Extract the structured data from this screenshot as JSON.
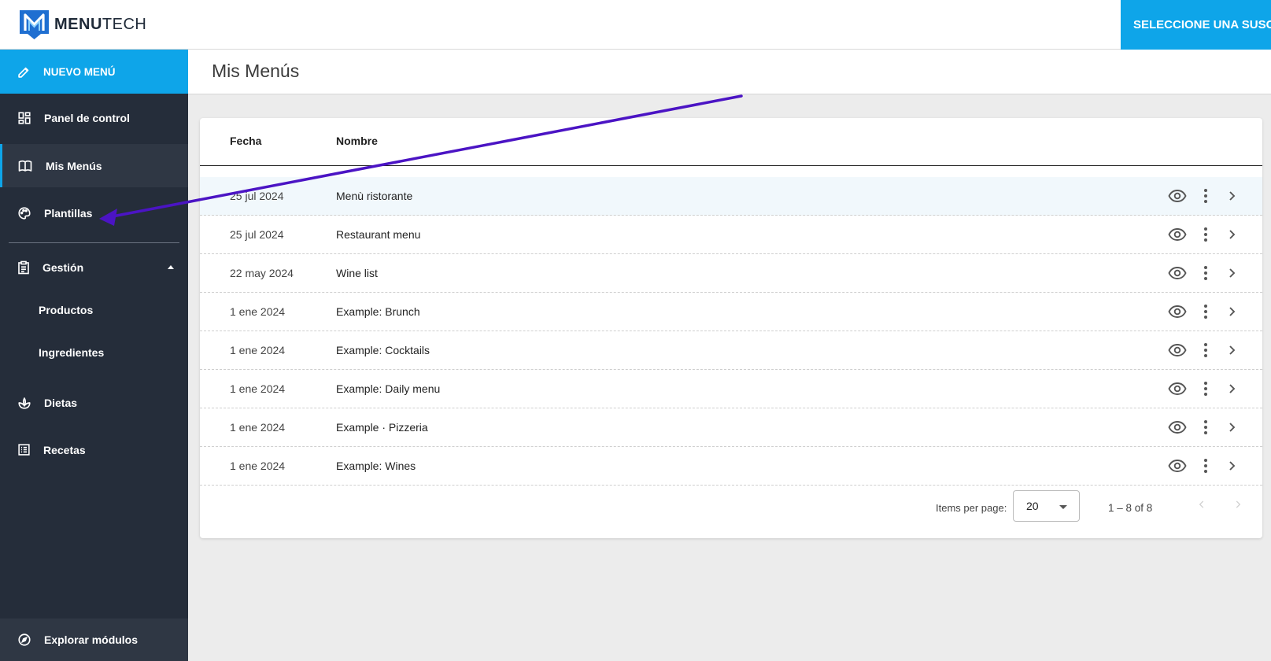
{
  "header": {
    "logo_bold": "MENU",
    "logo_light": "TECH",
    "subscribe_label": "SELECCIONE UNA SUSCR"
  },
  "sidebar": {
    "new_menu_label": "NUEVO MENÚ",
    "items": [
      {
        "label": "Panel de control",
        "icon": "dashboard-icon"
      },
      {
        "label": "Mis Menús",
        "icon": "book-icon",
        "active": true
      },
      {
        "label": "Plantillas",
        "icon": "palette-icon"
      }
    ],
    "management": {
      "label": "Gestión",
      "icon": "clipboard-icon",
      "expanded": true,
      "children": [
        {
          "label": "Productos"
        },
        {
          "label": "Ingredientes"
        }
      ]
    },
    "extra_items": [
      {
        "label": "Dietas",
        "icon": "sprout-icon"
      },
      {
        "label": "Recetas",
        "icon": "list-icon"
      }
    ],
    "explore_label": "Explorar módulos"
  },
  "page": {
    "title": "Mis Menús"
  },
  "table": {
    "columns": [
      "Fecha",
      "Nombre"
    ],
    "rows": [
      {
        "date": "25 jul 2024",
        "name": "Menù ristorante"
      },
      {
        "date": "25 jul 2024",
        "name": "Restaurant menu"
      },
      {
        "date": "22 may 2024",
        "name": "Wine list"
      },
      {
        "date": "1 ene 2024",
        "name": "Example: Brunch"
      },
      {
        "date": "1 ene 2024",
        "name": "Example: Cocktails"
      },
      {
        "date": "1 ene 2024",
        "name": "Example: Daily menu"
      },
      {
        "date": "1 ene 2024",
        "name": "Example · Pizzeria"
      },
      {
        "date": "1 ene 2024",
        "name": "Example: Wines"
      }
    ]
  },
  "paginator": {
    "items_per_page_label": "Items per page:",
    "items_per_page_value": "20",
    "range_label": "1 – 8 of 8"
  },
  "colors": {
    "accent": "#0ea5e9",
    "sidebar_bg": "#252d3a",
    "annotation_arrow": "#4b14c4"
  }
}
